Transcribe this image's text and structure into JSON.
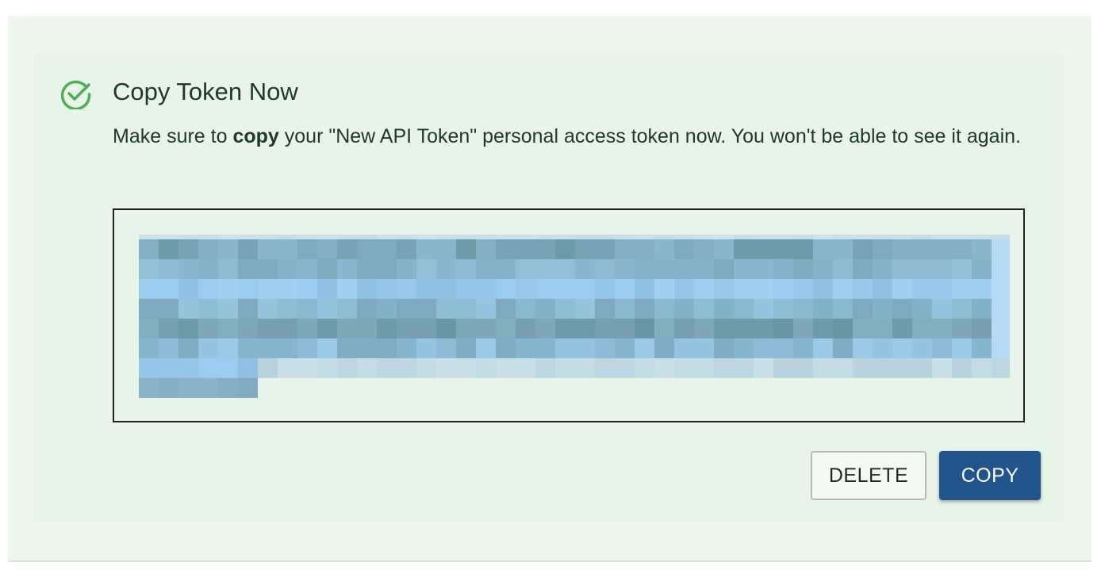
{
  "alert": {
    "title": "Copy Token Now",
    "message_before": "Make sure to ",
    "message_bold": "copy",
    "message_after": " your \"New API Token\" personal access token now. You won't be able to see it again.",
    "icon": "check-circle-icon",
    "icon_color": "#4caf50"
  },
  "token": {
    "redacted": true,
    "token_text": ""
  },
  "actions": {
    "delete_label": "DELETE",
    "copy_label": "COPY"
  },
  "colors": {
    "panel_background": "#e8f4ea",
    "text": "#1e3a24",
    "copy_button": "#22538a",
    "pixelation_hues": [
      "#7fa9bf",
      "#8bb8d2",
      "#9bcbef",
      "#6f9aa9",
      "#c6dde4"
    ]
  }
}
